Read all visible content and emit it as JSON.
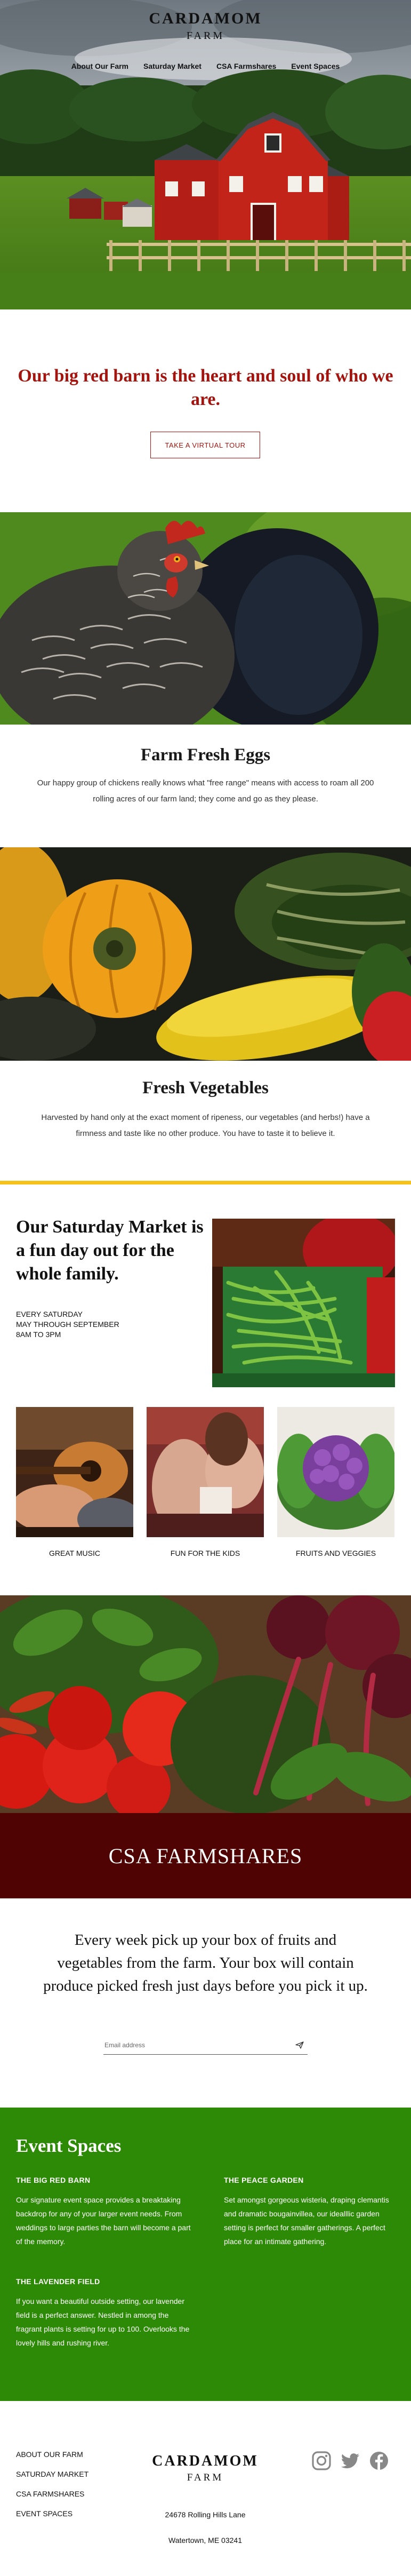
{
  "header": {
    "brand_name": "CARDAMOM",
    "brand_sub": "FARM",
    "nav": [
      "About Our Farm",
      "Saturday Market",
      "CSA Farmshares",
      "Event Spaces"
    ]
  },
  "intro": {
    "title": "Our big red barn is the heart and soul of who we are.",
    "button": "TAKE A VIRTUAL TOUR"
  },
  "eggs": {
    "title": "Farm Fresh Eggs",
    "text": "Our happy group of chickens really knows what \"free range\" means with access to roam all 200 rolling acres of our farm land; they come and go as they please."
  },
  "vegetables": {
    "title": "Fresh Vegetables",
    "text": "Harvested by hand only at the exact moment of ripeness, our vegetables (and herbs!) have a firmness and taste like no other produce. You have to taste it to believe it."
  },
  "market": {
    "title": "Our Saturday Market is a fun day out for the whole family.",
    "schedule": [
      "EVERY SATURDAY",
      "MAY THROUGH SEPTEMBER",
      "8AM TO 3PM"
    ],
    "captions": [
      "GREAT MUSIC",
      "FUN FOR THE KIDS",
      "FRUITS AND VEGGIES"
    ]
  },
  "csa": {
    "title": "CSA FARMSHARES",
    "text": "Every week pick up your box of fruits and vegetables from the farm. Your box will contain produce picked fresh just days before you pick it up.",
    "email_placeholder": "Email address"
  },
  "events": {
    "title": "Event Spaces",
    "spaces": [
      {
        "name": "THE BIG RED BARN",
        "text": "Our signature event space provides a breaktaking backdrop for any of your larger event needs. From weddings to large parties the barn will become a part of the memory."
      },
      {
        "name": "THE PEACE GARDEN",
        "text": "Set amongst gorgeous wisteria, draping clemantis and dramatic bougainvillea, our idealllic garden setting is perfect for smaller gatherings. A perfect place for an intimate gathering."
      },
      {
        "name": "THE LAVENDER FIELD",
        "text": "If you want a beautiful outside setting, our lavender field is a perfect answer. Nestled in among the fragrant plants is setting for up to 100. Overlooks the lovely hills and rushing river."
      }
    ]
  },
  "footer": {
    "links": [
      "ABOUT OUR FARM",
      "SATURDAY MARKET",
      "CSA FARMSHARES",
      "EVENT SPACES"
    ],
    "brand_name": "CARDAMOM",
    "brand_sub": "FARM",
    "address": [
      "24678 Rolling Hills Lane",
      "Watertown, ME 03241"
    ],
    "socials": [
      "instagram-icon",
      "twitter-icon",
      "facebook-icon"
    ]
  },
  "colors": {
    "accent_red": "#a3140e",
    "csa_bar": "#4f0303",
    "events_green": "#2d8a06",
    "market_rule": "#f4c21b"
  }
}
